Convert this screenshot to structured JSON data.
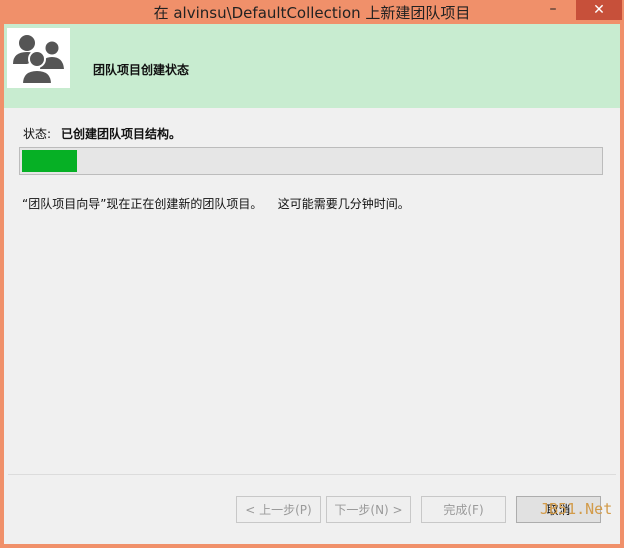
{
  "window": {
    "title": "在 alvinsu\\DefaultCollection 上新建团队项目",
    "minimize_glyph": "–",
    "close_glyph": "✕"
  },
  "header": {
    "title": "团队项目创建状态"
  },
  "status": {
    "label": "状态:",
    "value": "已创建团队项目结构。"
  },
  "progress": {
    "fraction": 0.095
  },
  "info": {
    "text": "“团队项目向导”现在正在创建新的团队项目。    这可能需要几分钟时间。"
  },
  "buttons": {
    "prev": "< 上一步(P)",
    "next": "下一步(N) >",
    "finish": "完成(F)",
    "cancel": "取消"
  },
  "watermark": {
    "text": "JB51.Net"
  },
  "colors": {
    "title_bar": "#f0906a",
    "header_band": "#c8ecd0",
    "progress_fill": "#06b025",
    "close_button": "#c7503a"
  }
}
